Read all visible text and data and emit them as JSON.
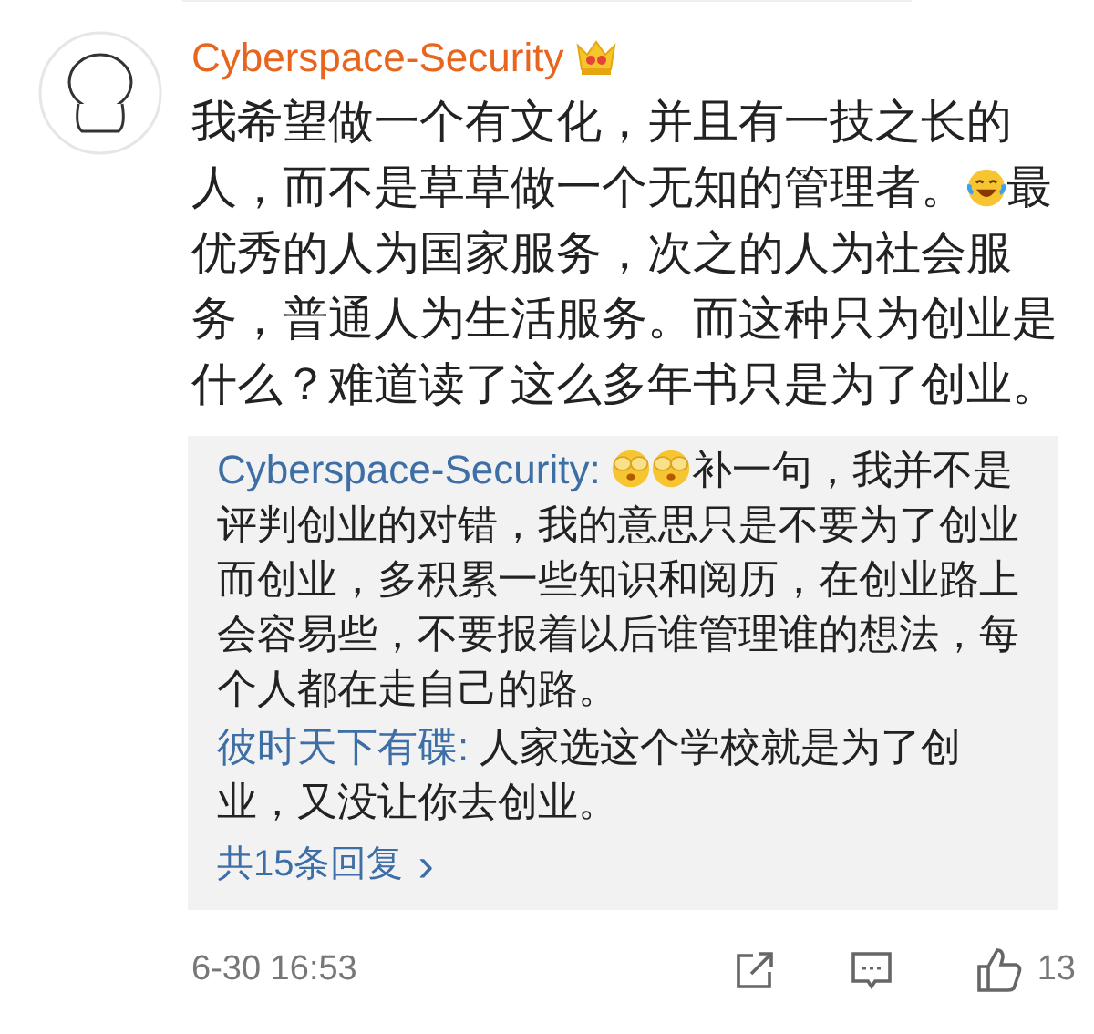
{
  "comment": {
    "author": "Cyberspace-Security",
    "crown_badge": true,
    "body_lines": [
      [
        {
          "kind": "text",
          "text": "我希望做一个有文化，并且有一技之长的"
        }
      ],
      [
        {
          "kind": "text",
          "text": "人，而不是草草做一个无知的管理者。"
        },
        {
          "kind": "laughing"
        },
        {
          "kind": "text",
          "text": "最"
        }
      ],
      [
        {
          "kind": "text",
          "text": "优秀的人为国家服务，次之的人为社会服"
        }
      ],
      [
        {
          "kind": "text",
          "text": "务，普通人为生活服务。而这种只为创业是"
        }
      ],
      [
        {
          "kind": "text",
          "text": "什么？难道读了这么多年书只是为了创业。"
        }
      ]
    ],
    "replies": [
      {
        "author": "Cyberspace-Security:",
        "body": [
          {
            "kind": "covering"
          },
          {
            "kind": "covering"
          },
          {
            "kind": "text",
            "text": "补一句，我并不是评判创业的对错，我的意思只是不要为了创业而创业，多积累一些知识和阅历，在创业路上会容易些，不要报着以后谁管理谁的想法，每个人都在走自己的路。"
          }
        ]
      },
      {
        "author": "彼时天下有碟:",
        "body": [
          {
            "kind": "text",
            "text": "人家选这个学校就是为了创业，又没让你去创业。"
          }
        ]
      }
    ],
    "more_replies": "共15条回复",
    "more_arrow": "›",
    "time": "6-30 16:53",
    "like_count": "13"
  }
}
